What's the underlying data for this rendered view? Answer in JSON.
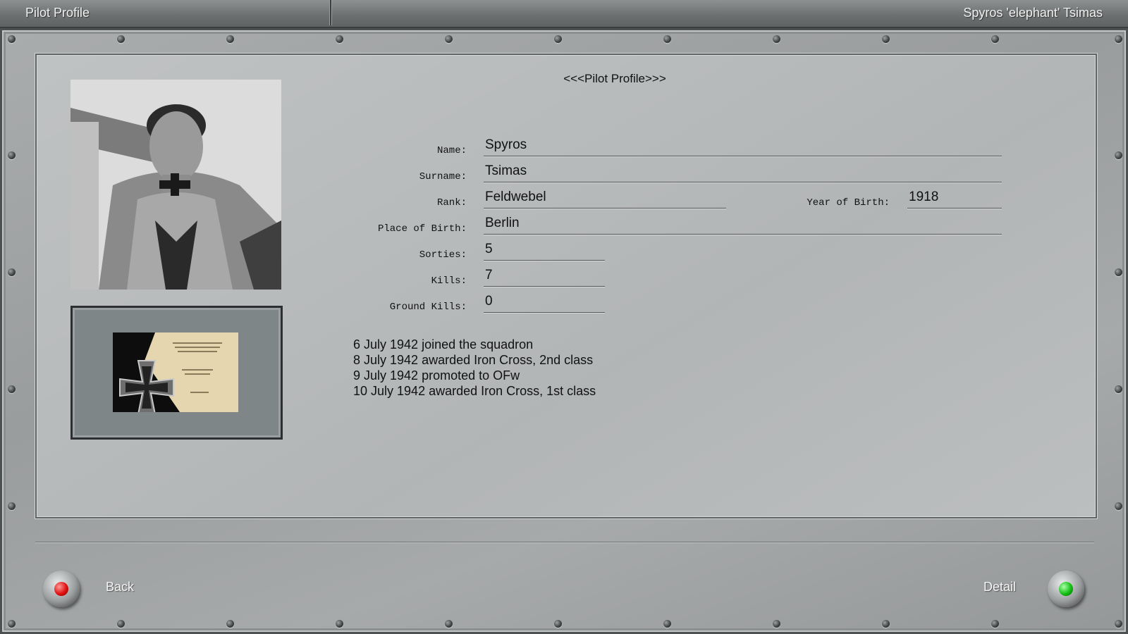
{
  "titlebar": {
    "left_title": "Pilot Profile",
    "right_title": "Spyros 'elephant' Tsimas"
  },
  "panel": {
    "heading": "<<<Pilot Profile>>>",
    "fields": {
      "name": {
        "label": "Name:",
        "value": "Spyros"
      },
      "surname": {
        "label": "Surname:",
        "value": "Tsimas"
      },
      "rank": {
        "label": "Rank:",
        "value": "Feldwebel"
      },
      "year_of_birth": {
        "label": "Year of Birth:",
        "value": "1918"
      },
      "place_of_birth": {
        "label": "Place of Birth:",
        "value": "Berlin"
      },
      "sorties": {
        "label": "Sorties:",
        "value": "5"
      },
      "kills": {
        "label": "Kills:",
        "value": "7"
      },
      "ground_kills": {
        "label": "Ground Kills:",
        "value": "0"
      }
    },
    "history": [
      "6 July 1942 joined the squadron",
      "8 July 1942 awarded Iron Cross, 2nd class",
      "9 July 1942 promoted to OFw",
      "10 July 1942 awarded Iron Cross, 1st class"
    ],
    "photo_icon": "pilot-portrait",
    "medal_icon": "iron-cross-certificate"
  },
  "footer": {
    "back_label": "Back",
    "detail_label": "Detail",
    "back_led_color": "#e01010",
    "detail_led_color": "#12c012"
  }
}
